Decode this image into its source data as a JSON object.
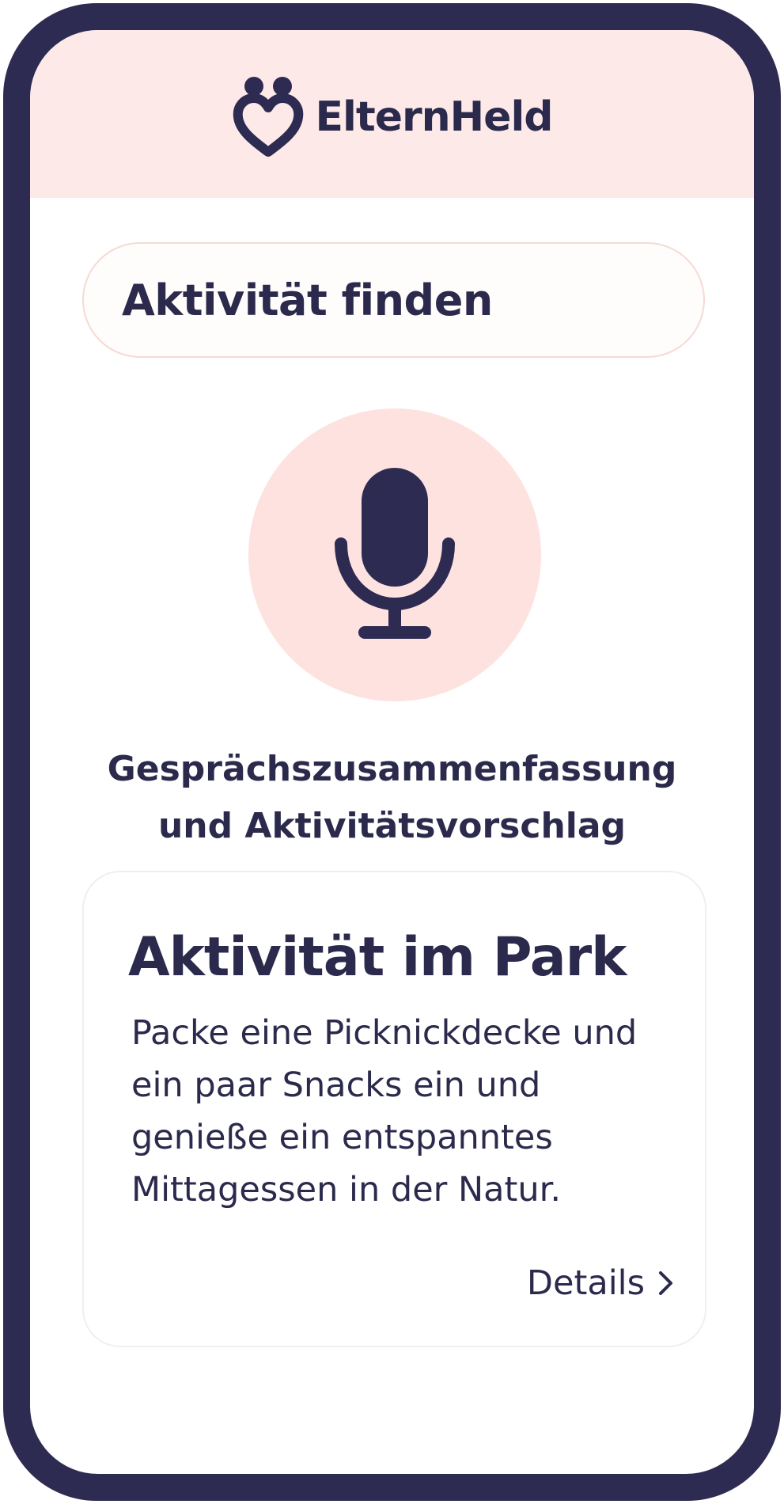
{
  "app": {
    "brand_name": "ElternHeld"
  },
  "search": {
    "label": "Aktivität finden"
  },
  "voice": {
    "icon": "microphone-icon"
  },
  "summary": {
    "line1": "Gesprächszusammenfassung",
    "line2": "und Aktivitätsvorschlag"
  },
  "card": {
    "title": "Aktivität im Park",
    "body": "Packe eine Picknickdecke und\nein paar Snacks ein und\ngenieße ein entspanntes\nMittagessen in der Natur.",
    "details_label": "Details",
    "details_icon": "chevron-right-icon"
  },
  "colors": {
    "frame": "#2e2b52",
    "text": "#2b2a4c",
    "header_bg": "#fdeae8",
    "mic_bg": "#fde2df"
  }
}
